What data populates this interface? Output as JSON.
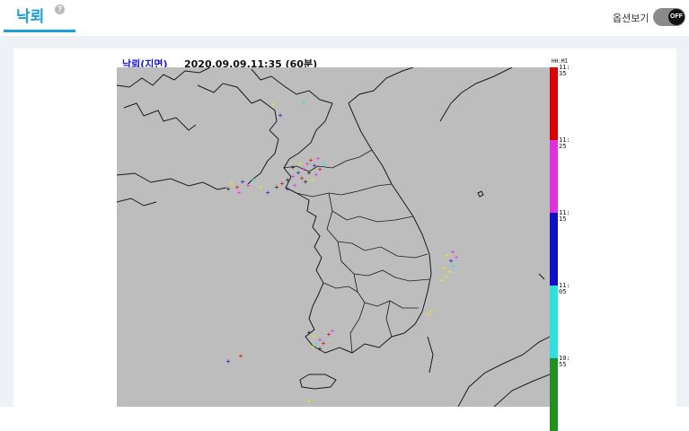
{
  "header": {
    "tab_title": "낙뢰",
    "help_icon": "?",
    "option_label": "옵션보기",
    "toggle_state": "OFF"
  },
  "map": {
    "caption_left": "낙뢰(지면)",
    "caption_time": "2020.09.09.11:35 (60분)",
    "scale_unit": "HH:MI",
    "land_color": "#bdbdbd",
    "border_color": "#1a1a1a"
  },
  "colorbar": {
    "segments": [
      {
        "color": "#dd0000",
        "label_hh": "11:",
        "label_mi": "35"
      },
      {
        "color": "#e030e0",
        "label_hh": "11:",
        "label_mi": "25"
      },
      {
        "color": "#1010c8",
        "label_hh": "11:",
        "label_mi": "15"
      },
      {
        "color": "#30e0e0",
        "label_hh": "11:",
        "label_mi": "05"
      },
      {
        "color": "#209020",
        "label_hh": "10:",
        "label_mi": "55"
      }
    ]
  }
}
